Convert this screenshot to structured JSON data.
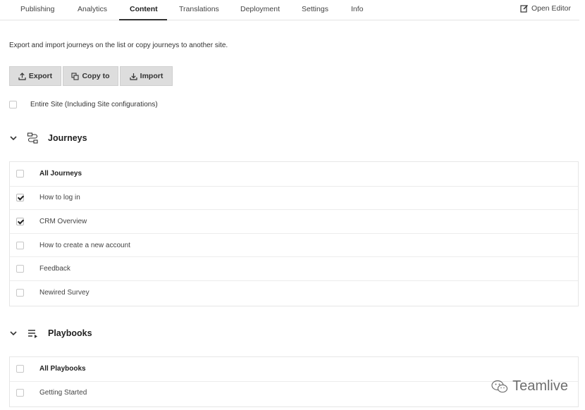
{
  "tabs": [
    {
      "label": "Publishing",
      "active": false
    },
    {
      "label": "Analytics",
      "active": false
    },
    {
      "label": "Content",
      "active": true
    },
    {
      "label": "Translations",
      "active": false
    },
    {
      "label": "Deployment",
      "active": false
    },
    {
      "label": "Settings",
      "active": false
    },
    {
      "label": "Info",
      "active": false
    }
  ],
  "open_editor": {
    "label": "Open Editor",
    "icon": "edit-icon"
  },
  "description": "Export and import journeys on the list or copy journeys to another site.",
  "actions": {
    "export": {
      "label": "Export",
      "icon": "upload-icon"
    },
    "copy": {
      "label": "Copy to",
      "icon": "copy-icon"
    },
    "import": {
      "label": "Import",
      "icon": "download-icon"
    }
  },
  "entire_site": {
    "label": "Entire Site (Including Site configurations)",
    "checked": false
  },
  "journeys": {
    "title": "Journeys",
    "icon": "journeys-icon",
    "header": {
      "label": "All Journeys",
      "checked": false
    },
    "items": [
      {
        "label": "How to log in",
        "checked": true
      },
      {
        "label": "CRM Overview",
        "checked": true
      },
      {
        "label": "How to create a new account",
        "checked": false
      },
      {
        "label": "Feedback",
        "checked": false
      },
      {
        "label": "Newired Survey",
        "checked": false
      }
    ]
  },
  "playbooks": {
    "title": "Playbooks",
    "icon": "playlist-icon",
    "header": {
      "label": "All Playbooks",
      "checked": false
    },
    "items": [
      {
        "label": "Getting Started",
        "checked": false
      }
    ]
  },
  "watermark": {
    "label": "Teamlive",
    "icon": "wechat-icon"
  }
}
